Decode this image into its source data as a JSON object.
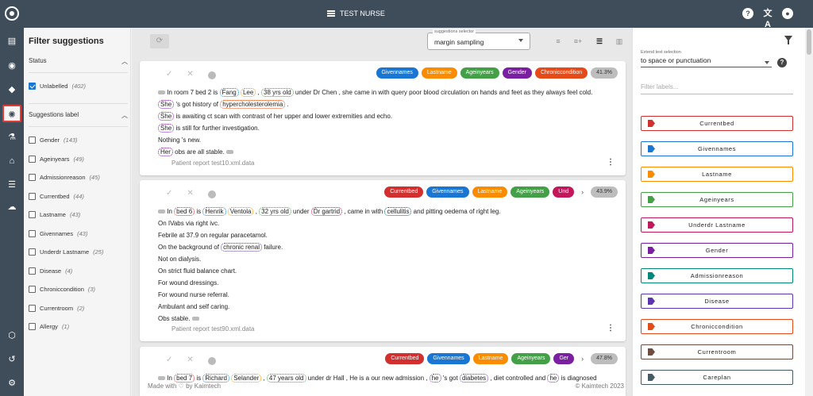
{
  "app": {
    "title": "TEST NURSE"
  },
  "rail": [
    "document-icon",
    "compass-icon",
    "tag-icon",
    "lightbulb-icon",
    "flask-icon",
    "bank-icon",
    "list-icon",
    "cloud-icon",
    "cube-icon",
    "history-icon",
    "settings-icon"
  ],
  "filter": {
    "title": "Filter suggestions",
    "status_label": "Status",
    "status_items": [
      {
        "label": "Unlabelled",
        "count": "(402)",
        "checked": true
      }
    ],
    "label_section": "Suggestions label",
    "label_items": [
      {
        "label": "Gender",
        "count": "(143)"
      },
      {
        "label": "Ageinyears",
        "count": "(49)"
      },
      {
        "label": "Admissionreason",
        "count": "(45)"
      },
      {
        "label": "Currentbed",
        "count": "(44)"
      },
      {
        "label": "Lastname",
        "count": "(43)"
      },
      {
        "label": "Givennames",
        "count": "(43)"
      },
      {
        "label": "Underdr Lastname",
        "count": "(25)"
      },
      {
        "label": "Disease",
        "count": "(4)"
      },
      {
        "label": "Chroniccondition",
        "count": "(3)"
      },
      {
        "label": "Currentroom",
        "count": "(2)"
      },
      {
        "label": "Allergy",
        "count": "(1)"
      }
    ]
  },
  "toolbar": {
    "selector_label": "suggestions selector",
    "selector_value": "margin sampling"
  },
  "colors": {
    "Currentbed": "#d32f2f",
    "Givennames": "#1976d2",
    "Lastname": "#fb8c00",
    "Ageinyears": "#43a047",
    "Underdr Lastname": "#c2185b",
    "Gender": "#7b1fa2",
    "Admissionreason": "#00897b",
    "Disease": "#5e35b1",
    "Chroniccondition": "#e64a19",
    "Currentroom": "#6d4c41",
    "Careplan": "#455a64",
    "Disease tag": "#006064"
  },
  "cards": [
    {
      "chips": [
        {
          "label": "Givennames",
          "color": "#1976d2"
        },
        {
          "label": "Lastname",
          "color": "#fb8c00"
        },
        {
          "label": "Ageinyears",
          "color": "#43a047"
        },
        {
          "label": "Gender",
          "color": "#7b1fa2"
        },
        {
          "label": "Chroniccondition",
          "color": "#e64a19"
        }
      ],
      "percent": "41.3%",
      "has_arrow": false,
      "lines": [
        [
          {
            "t": "In room 7 bed 2 is "
          },
          {
            "t": "Fang",
            "c": "#1976d2"
          },
          {
            "t": " "
          },
          {
            "t": "Lee",
            "c": "#fb8c00"
          },
          {
            "t": " , "
          },
          {
            "t": "38 yrs old",
            "c": "#43a047"
          },
          {
            "t": " under Dr Chen , she came in with query poor blood circulation on hands and feet as they always feel cold."
          }
        ],
        [
          {
            "t": "She",
            "c": "#7b1fa2"
          },
          {
            "t": " 's got history of "
          },
          {
            "t": "hypercholesterolemia",
            "c": "#e64a19"
          },
          {
            "t": " ."
          }
        ],
        [
          {
            "t": "She",
            "c": "#7b1fa2"
          },
          {
            "t": " is awaiting ct scan with contrast of her upper and lower extremities and echo."
          }
        ],
        [
          {
            "t": "She",
            "c": "#7b1fa2"
          },
          {
            "t": " is still for further investigation."
          }
        ],
        [
          {
            "t": "Nothing 's new."
          }
        ],
        [
          {
            "t": "Her",
            "c": "#7b1fa2"
          },
          {
            "t": " obs are all stable. "
          }
        ]
      ],
      "footer": "Patient report test10.xml.data"
    },
    {
      "chips": [
        {
          "label": "Currentbed",
          "color": "#d32f2f"
        },
        {
          "label": "Givennames",
          "color": "#1976d2"
        },
        {
          "label": "Lastname",
          "color": "#fb8c00"
        },
        {
          "label": "Ageinyears",
          "color": "#43a047"
        },
        {
          "label": "Und",
          "color": "#c2185b"
        }
      ],
      "percent": "43.9%",
      "has_arrow": true,
      "lines": [
        [
          {
            "t": "In "
          },
          {
            "t": "bed 6",
            "c": "#d32f2f"
          },
          {
            "t": " is "
          },
          {
            "t": "Henrik",
            "c": "#1976d2"
          },
          {
            "t": " "
          },
          {
            "t": "Ventola",
            "c": "#fb8c00"
          },
          {
            "t": " , "
          },
          {
            "t": "32 yrs old",
            "c": "#43a047"
          },
          {
            "t": " under "
          },
          {
            "t": "Dr gartrid",
            "c": "#c2185b"
          },
          {
            "t": " , came in with "
          },
          {
            "t": "cellulitis",
            "c": "#006064"
          },
          {
            "t": " and pitting oedema of right leg."
          }
        ],
        [
          {
            "t": "On IVabs via right ivc."
          }
        ],
        [
          {
            "t": "Febrile at 37.9 on regular paracetamol."
          }
        ],
        [
          {
            "t": "On the background of "
          },
          {
            "t": "chronic renal",
            "c": "#5e35b1"
          },
          {
            "t": " failure."
          }
        ],
        [
          {
            "t": "Not on dialysis."
          }
        ],
        [
          {
            "t": "On strict fluid balance chart."
          }
        ],
        [
          {
            "t": "For wound dressings."
          }
        ],
        [
          {
            "t": "For wound nurse referral."
          }
        ],
        [
          {
            "t": "Ambulant and self caring."
          }
        ],
        [
          {
            "t": "Obs stable. "
          }
        ]
      ],
      "footer": "Patient report test90.xml.data"
    },
    {
      "chips": [
        {
          "label": "Currentbed",
          "color": "#d32f2f"
        },
        {
          "label": "Givennames",
          "color": "#1976d2"
        },
        {
          "label": "Lastname",
          "color": "#fb8c00"
        },
        {
          "label": "Ageinyears",
          "color": "#43a047"
        },
        {
          "label": "Ger",
          "color": "#7b1fa2"
        }
      ],
      "percent": "47.8%",
      "has_arrow": true,
      "lines": [
        [
          {
            "t": "In "
          },
          {
            "t": "bed 7",
            "c": "#d32f2f"
          },
          {
            "t": " is "
          },
          {
            "t": "Richard",
            "c": "#1976d2"
          },
          {
            "t": " "
          },
          {
            "t": "Selander",
            "c": "#fb8c00"
          },
          {
            "t": " , "
          },
          {
            "t": "47 years old",
            "c": "#43a047"
          },
          {
            "t": " under dr Hall , He is a our new admission , "
          },
          {
            "t": "he",
            "c": "#7b1fa2"
          },
          {
            "t": " 's got "
          },
          {
            "t": "diabetes",
            "c": "#5e35b1"
          },
          {
            "t": " , diet controlled and "
          },
          {
            "t": "he",
            "c": "#7b1fa2"
          },
          {
            "t": " is diagnosed"
          }
        ]
      ],
      "footer": ""
    }
  ],
  "footer": {
    "left": "Made with ♡ by Kaimtech",
    "right": "©  Kaimtech 2023"
  },
  "right": {
    "extend_label": "Extend text selection",
    "extend_value": "to space or punctuation",
    "filter_placeholder": "Filter labels...",
    "labels": [
      {
        "name": "Currentbed",
        "color": "#d32f2f"
      },
      {
        "name": "Givennames",
        "color": "#1976d2"
      },
      {
        "name": "Lastname",
        "color": "#fb8c00"
      },
      {
        "name": "Ageinyears",
        "color": "#43a047"
      },
      {
        "name": "Underdr Lastname",
        "color": "#c2185b"
      },
      {
        "name": "Gender",
        "color": "#7b1fa2"
      },
      {
        "name": "Admissionreason",
        "color": "#00897b"
      },
      {
        "name": "Disease",
        "color": "#5e35b1"
      },
      {
        "name": "Chroniccondition",
        "color": "#e64a19"
      },
      {
        "name": "Currentroom",
        "color": "#6d4c41"
      },
      {
        "name": "Careplan",
        "color": "#455a64"
      }
    ]
  }
}
